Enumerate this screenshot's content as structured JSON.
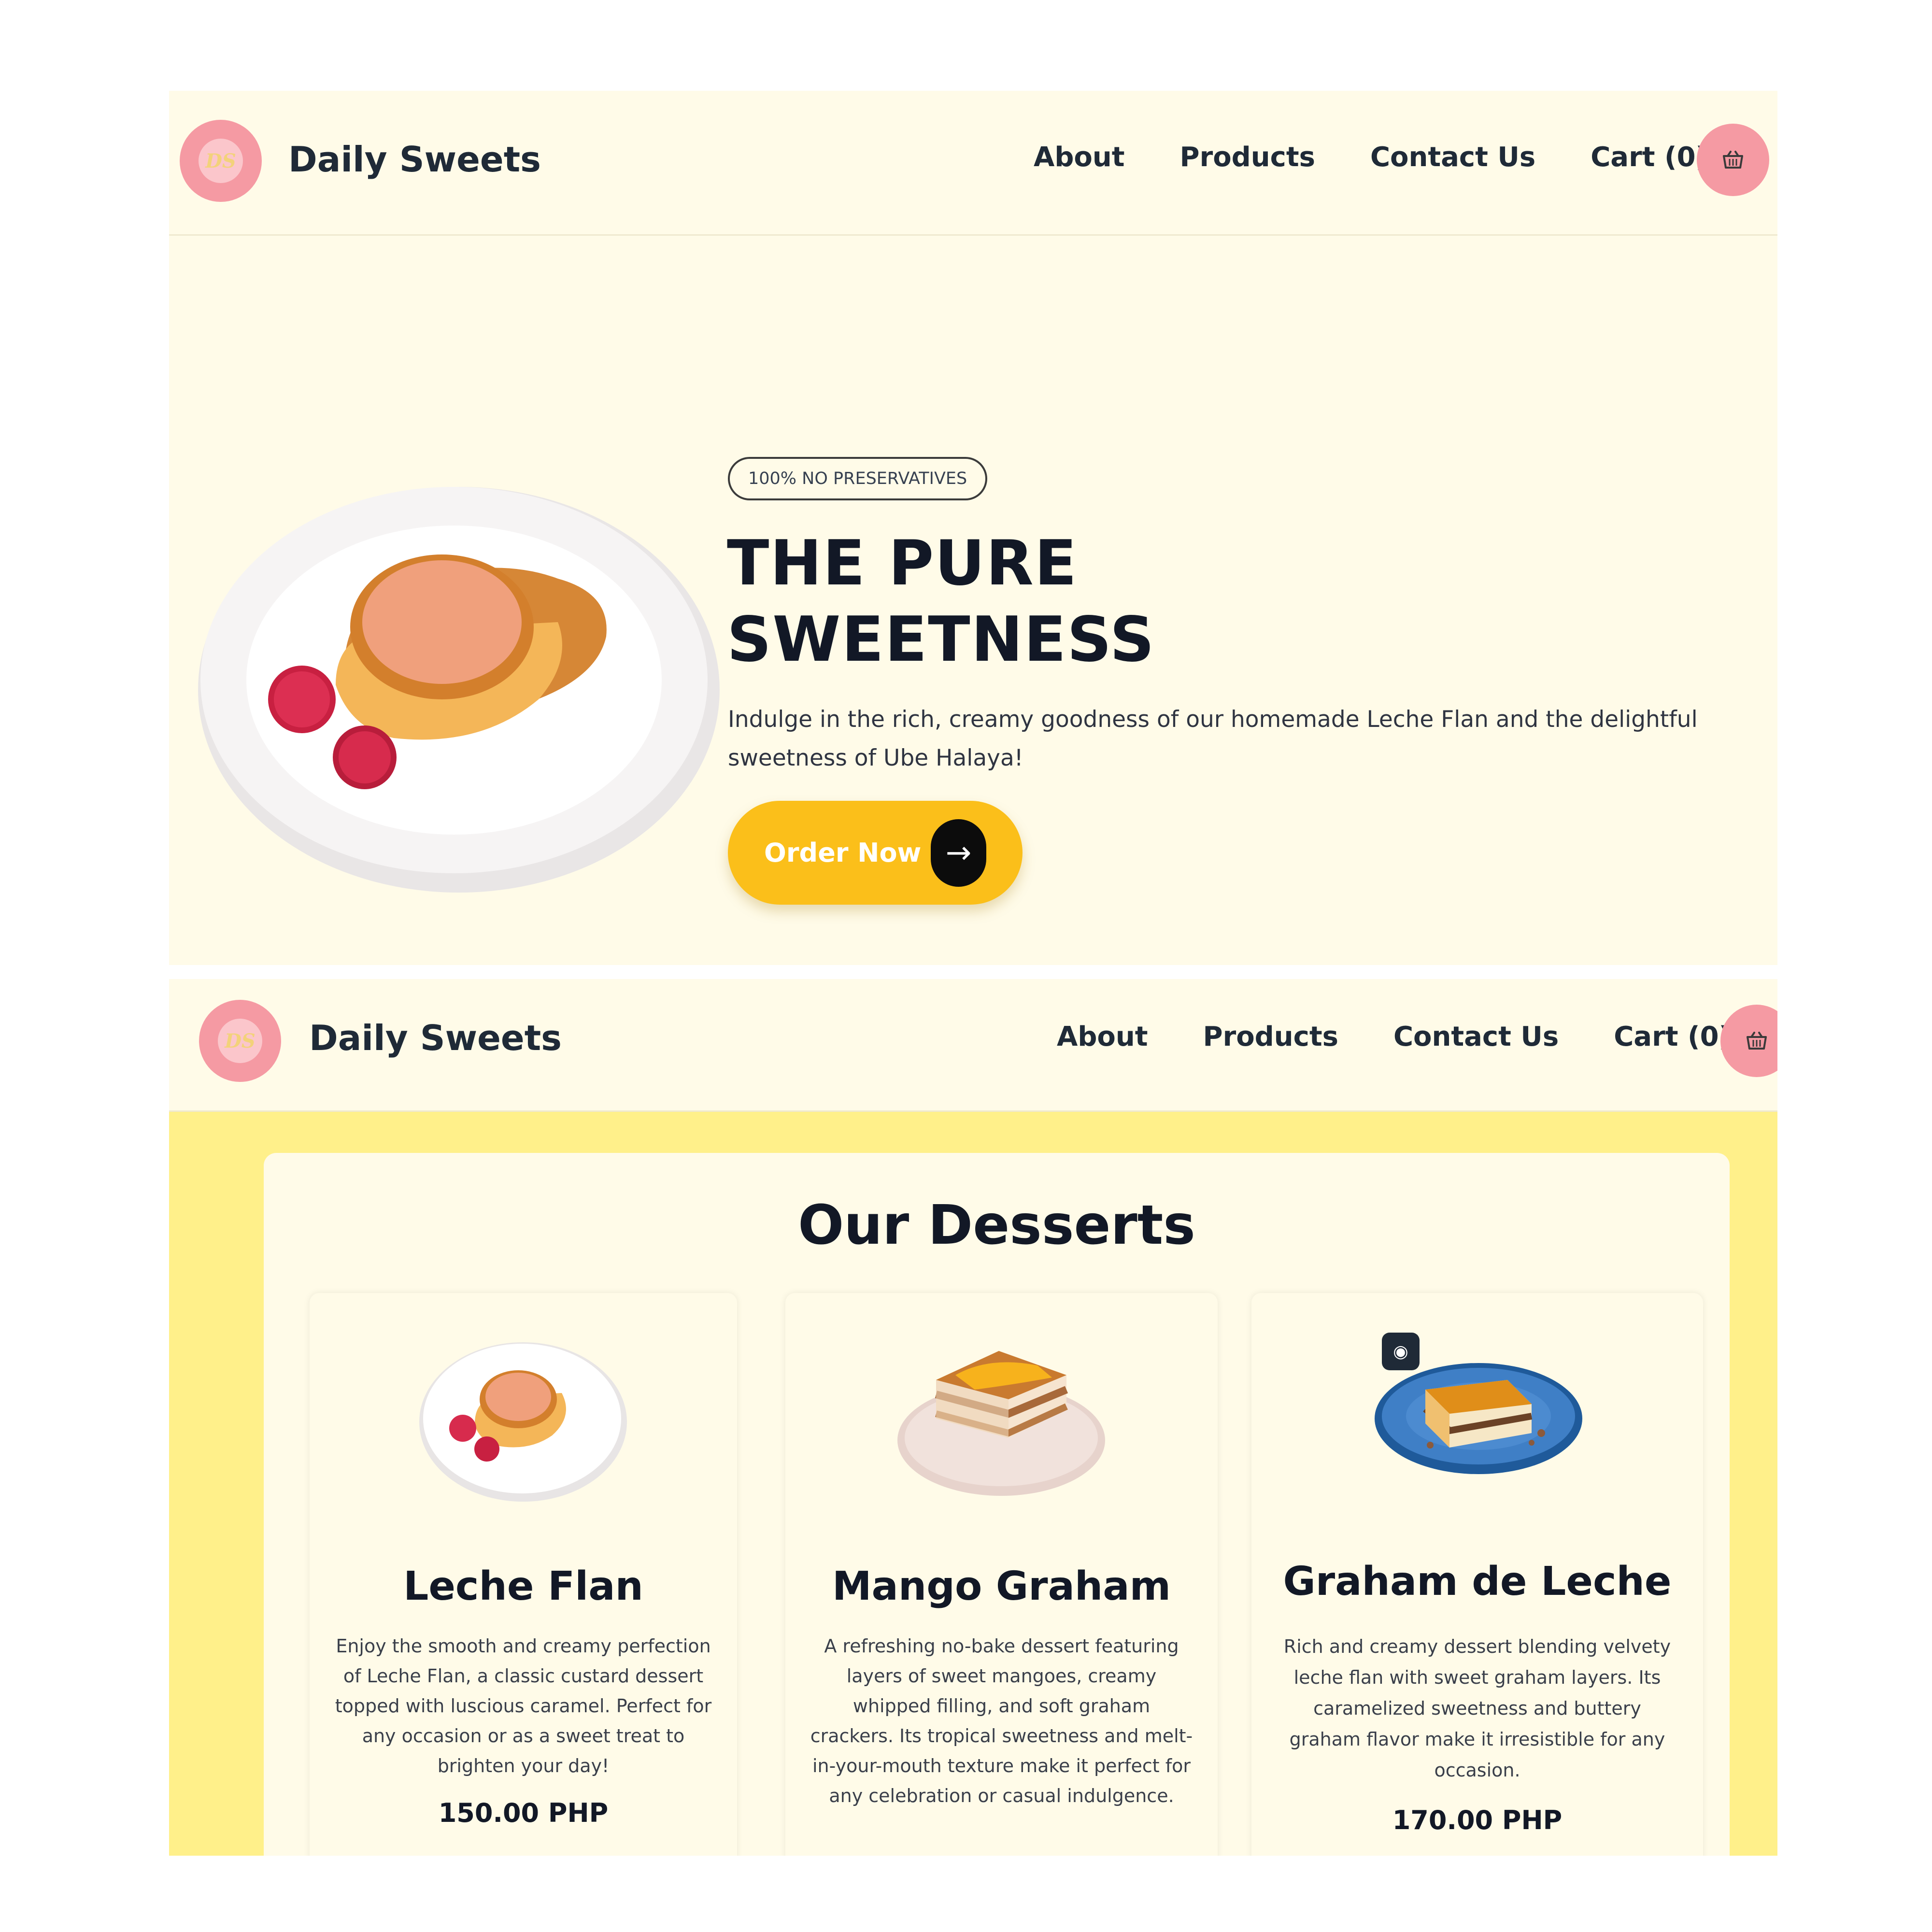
{
  "brand": {
    "name": "Daily Sweets",
    "logo_text": "DS",
    "colors": {
      "primary_pink": "#f59aa3",
      "accent_yellow": "#fbbf1a",
      "cream": "#fffbe8",
      "section_yellow": "#fff08a",
      "dark_text": "#121826"
    }
  },
  "nav": {
    "links": [
      "About",
      "Products",
      "Contact Us",
      "Cart (0)"
    ],
    "cart_icon": "basket-icon"
  },
  "hero": {
    "badge": "100% NO PRESERVATIVES",
    "title_line1": "THE PURE",
    "title_line2": "SWEETNESS",
    "description": "Indulge in the rich, creamy goodness of our homemade Leche Flan and the delightful sweetness of Ube Halaya!",
    "cta_label": "Order Now",
    "cta_icon": "arrow-right-icon",
    "arrow_glyph": "→"
  },
  "products": {
    "section_title": "Our Desserts",
    "items": [
      {
        "name": "Leche Flan",
        "description": "Enjoy the smooth and creamy perfection of Leche Flan, a classic custard dessert topped with luscious caramel. Perfect for any occasion or as a sweet treat to brighten your day!",
        "price": "150.00 PHP",
        "image": "leche-flan-image"
      },
      {
        "name": "Mango Graham",
        "description": "A refreshing no-bake dessert featuring layers of sweet mangoes, creamy whipped filling, and soft graham crackers. Its tropical sweetness and melt-in-your-mouth texture make it perfect for any celebration or casual indulgence.",
        "price": "",
        "image": "mango-graham-image"
      },
      {
        "name": "Graham de Leche",
        "description": "Rich and creamy dessert blending velvety leche flan with sweet graham layers. Its caramelized sweetness and buttery graham flavor make it irresistible for any occasion.",
        "price": "170.00 PHP",
        "image": "graham-de-leche-image"
      }
    ]
  }
}
